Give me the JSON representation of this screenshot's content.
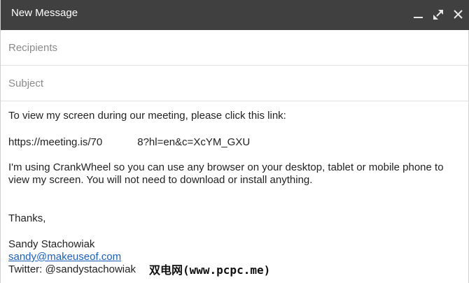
{
  "window": {
    "title": "New Message",
    "controls": [
      "minimize-icon",
      "expand-icon",
      "close-icon"
    ]
  },
  "recipients": {
    "placeholder": "Recipients",
    "value": ""
  },
  "subject": {
    "placeholder": "Subject",
    "value": ""
  },
  "message": {
    "intro": "To view my screen during our meeting, please click this link:",
    "url_part1": "https://meeting.is/70",
    "url_part2": "8?hl=en&c=XcYM_GXU",
    "para_line1": "I'm using CrankWheel so you can use any browser on your desktop, tablet or mobile phone to",
    "para_line2": "view my screen. You will not need to download or install anything.",
    "closing": "Thanks,",
    "sig_name": "Sandy Stachowiak",
    "sig_email": "sandy@makeuseof.com",
    "sig_twitter": "Twitter: @sandystachowiak"
  },
  "watermark": "双电网(www.pcpc.me)",
  "colors": {
    "titlebar": "#404040",
    "link": "#1a5fbf",
    "placeholder": "#8a8a8a"
  }
}
